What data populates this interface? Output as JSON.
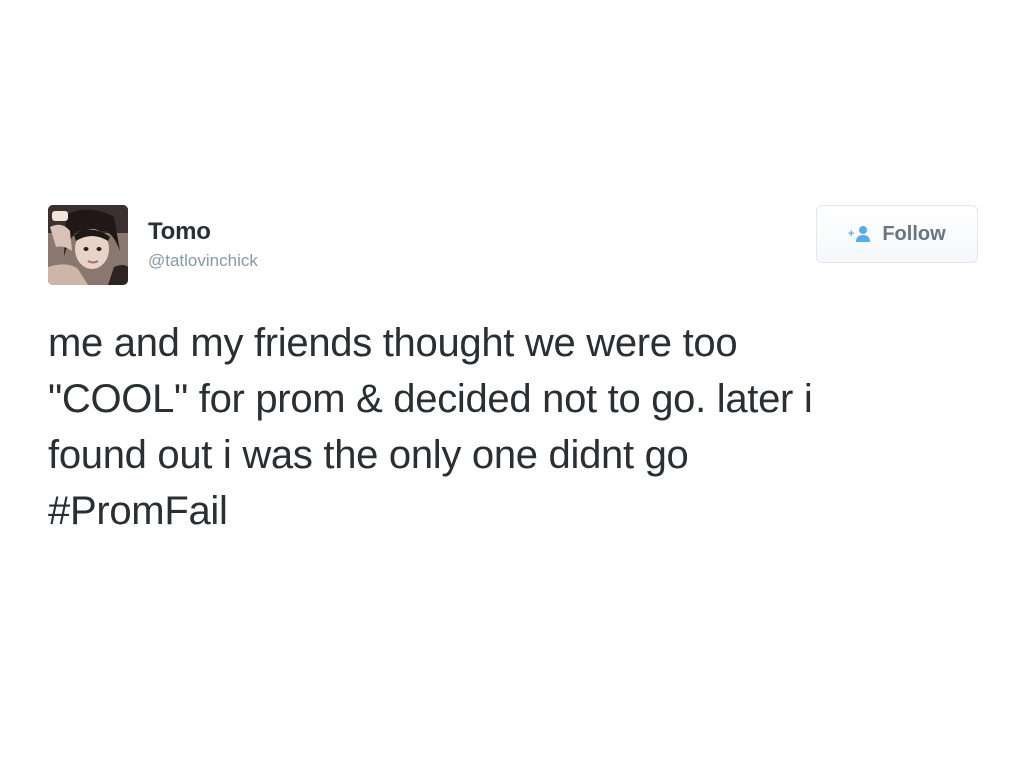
{
  "tweet": {
    "display_name": "Tomo",
    "screen_name": "@tatlovinchick",
    "follow_label": "Follow",
    "text_lines": [
      "me and my friends thought we were too",
      "\"COOL\" for prom & decided not to go. later i",
      "found out i was the only one didnt go"
    ],
    "hashtag": "#PromFail"
  },
  "icons": {
    "follow": "add-user-icon",
    "avatar": "profile-photo"
  },
  "colors": {
    "text": "#292f33",
    "muted": "#8899a6",
    "follow_icon": "#55acee",
    "follow_border": "#e1e8ed"
  }
}
